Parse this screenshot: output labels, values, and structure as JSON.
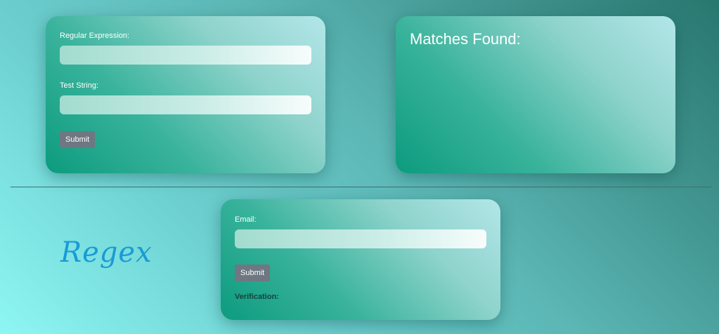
{
  "regex_form": {
    "regex_label": "Regular Expression:",
    "regex_value": "",
    "test_label": "Test String:",
    "test_value": "",
    "submit_label": "Submit"
  },
  "matches": {
    "title": "Matches Found:"
  },
  "email_form": {
    "email_label": "Email:",
    "email_value": "",
    "submit_label": "Submit",
    "verification_label": "Verification:"
  },
  "brand": {
    "text": "Regex",
    "color": "#1a9ad6"
  },
  "colors": {
    "button": "#6f7782",
    "card_gradient_start": "#0c9b7e",
    "card_gradient_end": "#b3e6e8",
    "background_start": "#8ef6f3",
    "background_end": "#28776f"
  }
}
